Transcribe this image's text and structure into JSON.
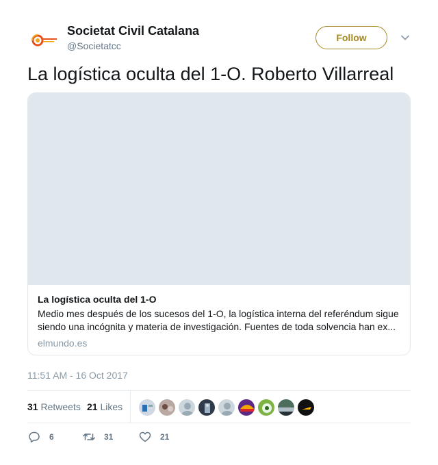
{
  "author": {
    "display_name": "Societat Civil Catalana",
    "handle": "@Societatcc",
    "follow_label": "Follow",
    "brand_color": "#a3891f"
  },
  "tweet": {
    "text": "La logística oculta del 1-O. Roberto Villarreal",
    "timestamp": "11:51 AM - 16 Oct 2017"
  },
  "card": {
    "title": "La logística oculta del 1-O",
    "description": "Medio mes después de los sucesos del 1-O, la logística interna del referéndum sigue siendo una incógnita y materia de investigación. Fuentes de toda solvencia han ex...",
    "domain": "elmundo.es"
  },
  "stats": {
    "retweets_count": "31",
    "retweets_label": "Retweets",
    "likes_count": "21",
    "likes_label": "Likes"
  },
  "actions": {
    "reply_count": "6",
    "retweet_count": "31",
    "like_count": "21"
  },
  "icons": {
    "reply": "reply-icon",
    "retweet": "retweet-icon",
    "like": "heart-icon",
    "caret": "chevron-down-icon"
  }
}
